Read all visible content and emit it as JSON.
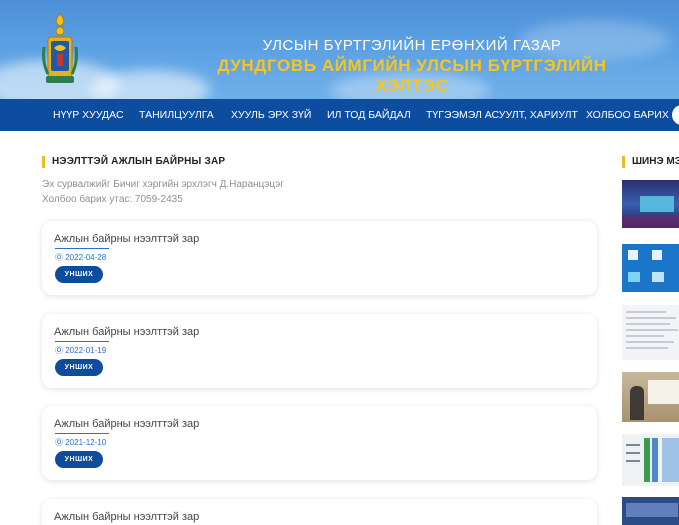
{
  "header": {
    "line1": "УЛСЫН БҮРТГЭЛИЙН ЕРӨНХИЙ ГАЗАР",
    "line2": "ДУНДГОВЬ АЙМГИЙН УЛСЫН БҮРТГЭЛИЙН ХЭЛТЭС"
  },
  "nav": {
    "items": [
      {
        "label": "НҮҮР ХУУДАС"
      },
      {
        "label": "ТАНИЛЦУУЛГА"
      },
      {
        "label": "ХУУЛЬ ЭРХ ЗҮЙ"
      },
      {
        "label": "ИЛ ТОД БАЙДАЛ"
      },
      {
        "label": "ТҮГЭЭМЭЛ АСУУЛТ, ХАРИУЛТ"
      },
      {
        "label": "ХОЛБОО БАРИХ"
      }
    ]
  },
  "main": {
    "section_title": "НЭЭЛТТЭЙ АЖЛЫН БАЙРНЫ ЗАР",
    "source": "Эх сурвалжийг Бичиг хэргийн эрхлэгч Д.Наранцэцэг",
    "contact": "Холбоо барих утас: 7059-2435",
    "posts": [
      {
        "title": "Ажлын байрны нээлттэй зар",
        "date": "2022-04-28",
        "button": "УНШИХ"
      },
      {
        "title": "Ажлын байрны нээлттэй зар",
        "date": "2022-01-19",
        "button": "УНШИХ"
      },
      {
        "title": "Ажлын байрны нээлттэй зар",
        "date": "2021-12-10",
        "button": "УНШИХ"
      },
      {
        "title": "Ажлын байрны нээлттэй зар"
      }
    ]
  },
  "sidebar": {
    "title": "ШИНЭ МЭДЭЭ"
  },
  "colors": {
    "nav_bg": "#0d4da0",
    "accent_gold": "#f8c41f",
    "button_blue": "#0f4c9c",
    "date_blue": "#2a6fc9"
  }
}
